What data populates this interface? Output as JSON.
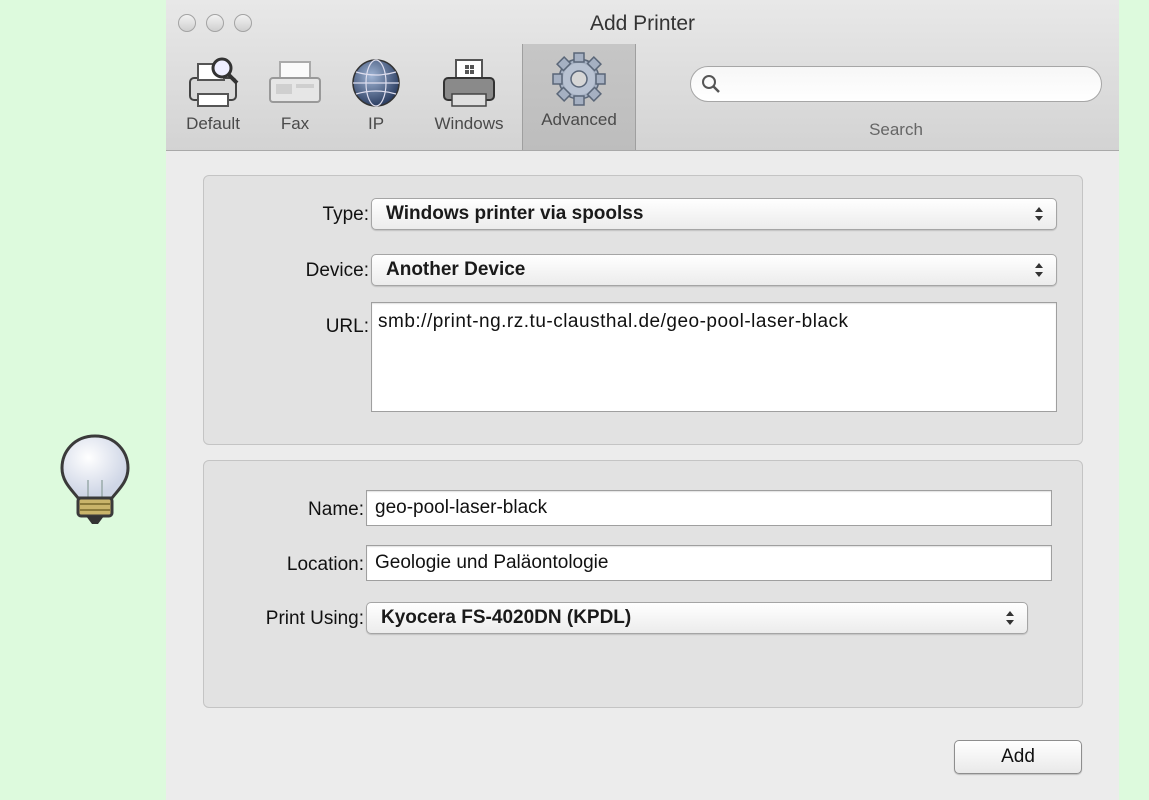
{
  "window": {
    "title": "Add Printer"
  },
  "toolbar": {
    "tools": [
      {
        "label": "Default",
        "icon": "printer-magnifier-icon"
      },
      {
        "label": "Fax",
        "icon": "fax-icon"
      },
      {
        "label": "IP",
        "icon": "globe-icon"
      },
      {
        "label": "Windows",
        "icon": "windows-printer-icon"
      },
      {
        "label": "Advanced",
        "icon": "gear-icon",
        "selected": true
      }
    ],
    "search": {
      "label": "Search",
      "value": "",
      "placeholder": ""
    }
  },
  "connection": {
    "type_label": "Type:",
    "type_value": "Windows printer via spoolss",
    "device_label": "Device:",
    "device_value": "Another Device",
    "url_label": "URL:",
    "url_value": "smb://print-ng.rz.tu-clausthal.de/geo-pool-laser-black"
  },
  "printer": {
    "name_label": "Name:",
    "name_value": "geo-pool-laser-black",
    "location_label": "Location:",
    "location_value": "Geologie und Paläontologie",
    "print_using_label": "Print Using:",
    "print_using_value": "Kyocera FS-4020DN (KPDL)"
  },
  "actions": {
    "add_label": "Add"
  },
  "colors": {
    "page_background": "#ddfadd",
    "window_background": "#ececec"
  }
}
